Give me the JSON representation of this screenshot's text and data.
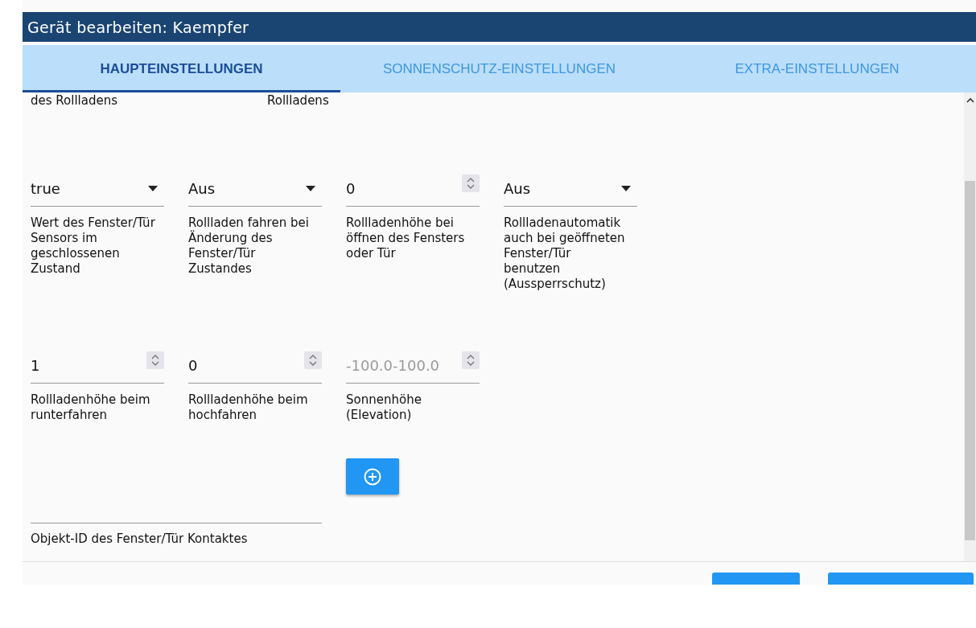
{
  "dialog": {
    "title": "Gerät bearbeiten: Kaempfer"
  },
  "tabs": [
    {
      "label": "HAUPTEINSTELLUNGEN",
      "selected": true
    },
    {
      "label": "SONNENSCHUTZ-EINSTELLUNGEN",
      "selected": false
    },
    {
      "label": "EXTRA-EINSTELLUNGEN",
      "selected": false
    }
  ],
  "scrolled_labels": [
    "des Rollladens",
    "Rollladens"
  ],
  "field_rows": [
    [
      {
        "kind": "select",
        "value": "true",
        "label": "Wert des Fenster/Tür Sensors im geschlossenen Zustand"
      },
      {
        "kind": "select",
        "value": "Aus",
        "label": "Rollladen fahren bei Änderung des Fenster/Tür Zustandes"
      },
      {
        "kind": "number",
        "value": "0",
        "label": "Rollladenhöhe bei öffnen des Fensters oder Tür"
      },
      {
        "kind": "select",
        "value": "Aus",
        "label": "Rollladenautomatik auch bei geöffneten Fenster/Tür benutzen (Aussperrschutz)"
      }
    ],
    [
      {
        "kind": "number",
        "value": "1",
        "label": "Rollladenhöhe beim runterfahren"
      },
      {
        "kind": "number",
        "value": "0",
        "label": "Rollladenhöhe beim hochfahren"
      },
      {
        "kind": "number",
        "placeholder": "-100.0-100.0",
        "label": "Sonnenhöhe (Elevation)"
      }
    ]
  ],
  "object_field": {
    "label": "Objekt-ID des Fenster/Tür Kontaktes"
  }
}
